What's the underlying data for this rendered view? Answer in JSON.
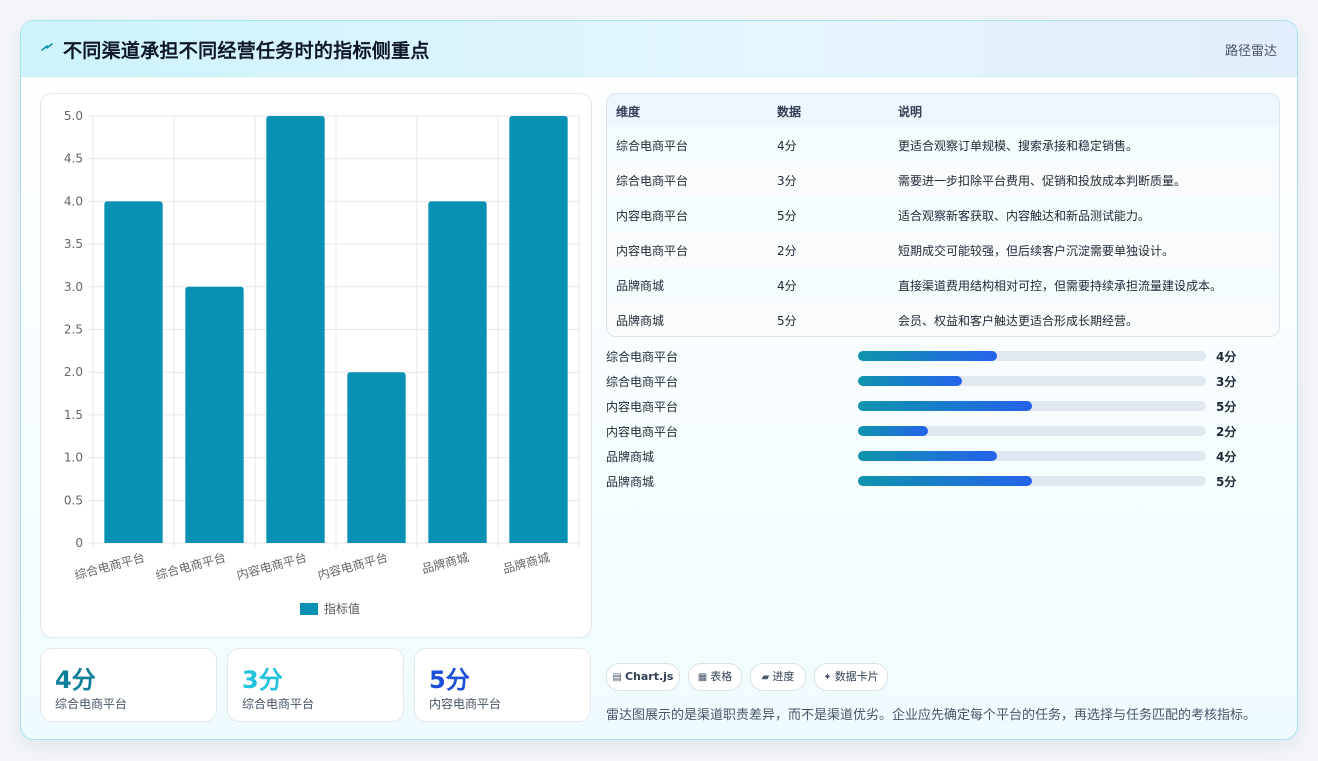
{
  "header": {
    "title": "不同渠道承担不同经营任务时的指标侧重点",
    "tag": "路径雷达"
  },
  "colors": {
    "bar": "#0891b2",
    "accent_teal": "#0e94ac",
    "accent_cyan": "#22c1dc",
    "accent_blue": "#1d4ed8",
    "grid": "#e5e7eb"
  },
  "chart_data": {
    "type": "bar",
    "categories": [
      "综合电商平台",
      "综合电商平台",
      "内容电商平台",
      "内容电商平台",
      "品牌商城",
      "品牌商城"
    ],
    "series": [
      {
        "name": "指标值",
        "values": [
          4,
          3,
          5,
          2,
          4,
          5
        ]
      }
    ],
    "ylim": [
      0,
      5
    ],
    "yticks": [
      "0",
      "0.5",
      "1.0",
      "1.5",
      "2.0",
      "2.5",
      "3.0",
      "3.5",
      "4.0",
      "4.5",
      "5.0"
    ],
    "grid": true,
    "legend": "bottom"
  },
  "kpis": [
    {
      "value": "4分",
      "label": "综合电商平台",
      "color": "#0e7f99"
    },
    {
      "value": "3分",
      "label": "综合电商平台",
      "color": "#22c1dc"
    },
    {
      "value": "5分",
      "label": "内容电商平台",
      "color": "#1d4ed8"
    }
  ],
  "table": {
    "headers": [
      "维度",
      "数据",
      "说明"
    ],
    "rows": [
      [
        "综合电商平台",
        "4分",
        "更适合观察订单规模、搜索承接和稳定销售。"
      ],
      [
        "综合电商平台",
        "3分",
        "需要进一步扣除平台费用、促销和投放成本判断质量。"
      ],
      [
        "内容电商平台",
        "5分",
        "适合观察新客获取、内容触达和新品测试能力。"
      ],
      [
        "内容电商平台",
        "2分",
        "短期成交可能较强，但后续客户沉淀需要单独设计。"
      ],
      [
        "品牌商城",
        "4分",
        "直接渠道费用结构相对可控，但需要持续承担流量建设成本。"
      ],
      [
        "品牌商城",
        "5分",
        "会员、权益和客户触达更适合形成长期经营。"
      ]
    ]
  },
  "progress": [
    {
      "label": "综合电商平台",
      "value": 4,
      "max": 10,
      "text": "4分"
    },
    {
      "label": "综合电商平台",
      "value": 3,
      "max": 10,
      "text": "3分"
    },
    {
      "label": "内容电商平台",
      "value": 5,
      "max": 10,
      "text": "5分"
    },
    {
      "label": "内容电商平台",
      "value": 2,
      "max": 10,
      "text": "2分"
    },
    {
      "label": "品牌商城",
      "value": 4,
      "max": 10,
      "text": "4分"
    },
    {
      "label": "品牌商城",
      "value": 5,
      "max": 10,
      "text": "5分"
    }
  ],
  "pills": [
    {
      "icon": "chart-icon",
      "glyph": "▤",
      "label": "Chart.js"
    },
    {
      "icon": "table-icon",
      "glyph": "▦",
      "label": "表格"
    },
    {
      "icon": "progress-icon",
      "glyph": "▰",
      "label": "进度"
    },
    {
      "icon": "sparkle-icon",
      "glyph": "✦",
      "label": "数据卡片"
    }
  ],
  "note": "雷达图展示的是渠道职责差异，而不是渠道优劣。企业应先确定每个平台的任务，再选择与任务匹配的考核指标。"
}
